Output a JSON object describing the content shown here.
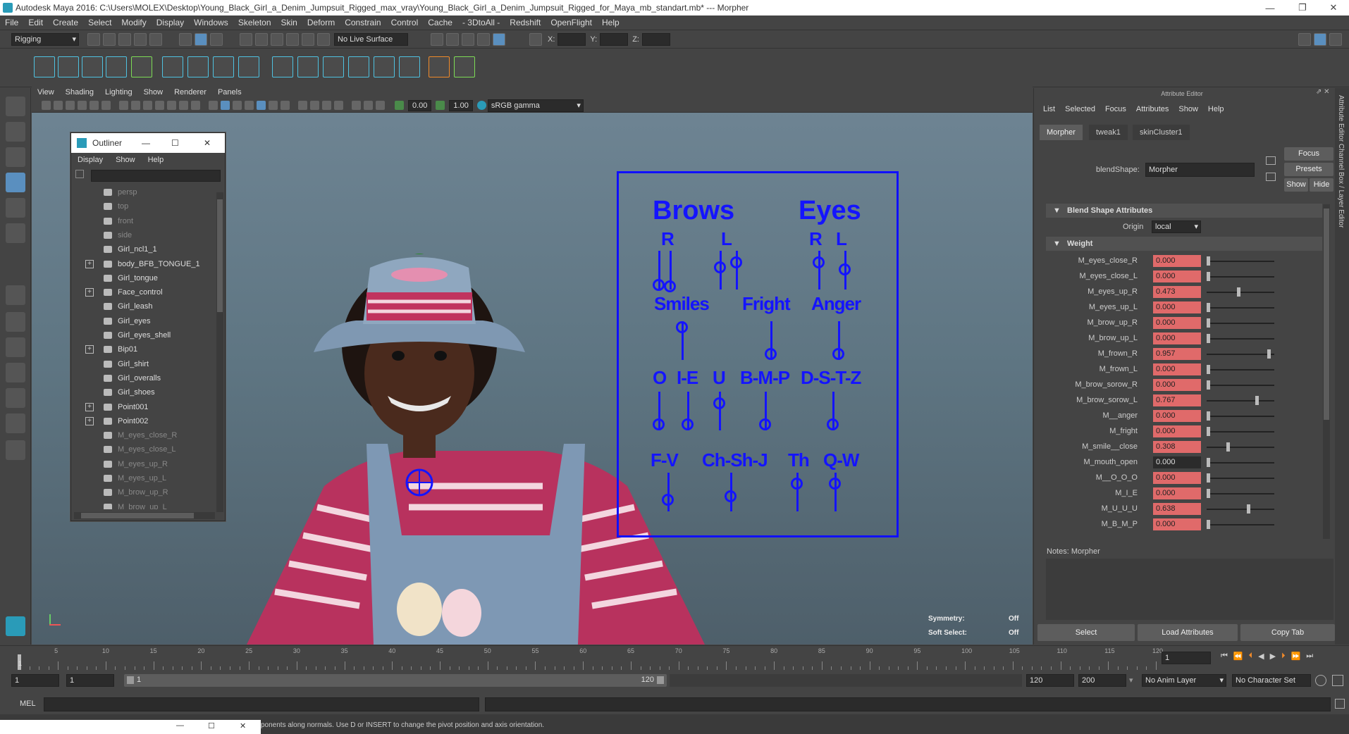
{
  "window": {
    "title": "Autodesk Maya 2016: C:\\Users\\MOLEX\\Desktop\\Young_Black_Girl_a_Denim_Jumpsuit_Rigged_max_vray\\Young_Black_Girl_a_Denim_Jumpsuit_Rigged_for_Maya_mb_standart.mb*  ---  Morpher"
  },
  "menu": [
    "File",
    "Edit",
    "Create",
    "Select",
    "Modify",
    "Display",
    "Windows",
    "Skeleton",
    "Skin",
    "Deform",
    "Constrain",
    "Control",
    "Cache",
    "- 3DtoAll -",
    "Redshift",
    "OpenFlight",
    "Help"
  ],
  "status": {
    "mode": "Rigging",
    "live_surface": "No Live Surface",
    "x": "X:",
    "y": "Y:",
    "z": "Z:"
  },
  "viewport": {
    "menu": [
      "View",
      "Shading",
      "Lighting",
      "Show",
      "Renderer",
      "Panels"
    ],
    "near": "0.00",
    "far": "1.00",
    "gamma": "sRGB gamma",
    "camera": "persp",
    "symmetry_label": "Symmetry:",
    "symmetry_value": "Off",
    "soft_label": "Soft Select:",
    "soft_value": "Off"
  },
  "face_panel": {
    "brows": "Brows",
    "eyes": "Eyes",
    "r1": "R",
    "l1": "L",
    "r2": "R",
    "l2": "L",
    "smiles": "Smiles",
    "fright": "Fright",
    "anger": "Anger",
    "o": "O",
    "ie": "I-E",
    "u": "U",
    "bmp": "B-M-P",
    "dstz": "D-S-T-Z",
    "fv": "F-V",
    "chshj": "Ch-Sh-J",
    "th": "Th",
    "qw": "Q-W"
  },
  "outliner": {
    "title": "Outliner",
    "menu": [
      "Display",
      "Show",
      "Help"
    ],
    "items": [
      {
        "label": "persp",
        "dim": true,
        "expand": false
      },
      {
        "label": "top",
        "dim": true,
        "expand": false
      },
      {
        "label": "front",
        "dim": true,
        "expand": false
      },
      {
        "label": "side",
        "dim": true,
        "expand": false
      },
      {
        "label": "Girl_ncl1_1",
        "dim": false,
        "expand": false
      },
      {
        "label": "body_BFB_TONGUE_1",
        "dim": false,
        "expand": true
      },
      {
        "label": "Girl_tongue",
        "dim": false,
        "expand": false
      },
      {
        "label": "Face_control",
        "dim": false,
        "expand": true
      },
      {
        "label": "Girl_leash",
        "dim": false,
        "expand": false
      },
      {
        "label": "Girl_eyes",
        "dim": false,
        "expand": false
      },
      {
        "label": "Girl_eyes_shell",
        "dim": false,
        "expand": false
      },
      {
        "label": "Bip01",
        "dim": false,
        "expand": true
      },
      {
        "label": "Girl_shirt",
        "dim": false,
        "expand": false
      },
      {
        "label": "Girl_overalls",
        "dim": false,
        "expand": false
      },
      {
        "label": "Girl_shoes",
        "dim": false,
        "expand": false
      },
      {
        "label": "Point001",
        "dim": false,
        "expand": true
      },
      {
        "label": "Point002",
        "dim": false,
        "expand": true
      },
      {
        "label": "M_eyes_close_R",
        "dim": true,
        "expand": false
      },
      {
        "label": "M_eyes_close_L",
        "dim": true,
        "expand": false
      },
      {
        "label": "M_eyes_up_R",
        "dim": true,
        "expand": false
      },
      {
        "label": "M_eyes_up_L",
        "dim": true,
        "expand": false
      },
      {
        "label": "M_brow_up_R",
        "dim": true,
        "expand": false
      },
      {
        "label": "M_brow_up_L",
        "dim": true,
        "expand": false
      }
    ]
  },
  "attr": {
    "title": "Attribute Editor",
    "menu": [
      "List",
      "Selected",
      "Focus",
      "Attributes",
      "Show",
      "Help"
    ],
    "tabs": [
      "Morpher",
      "tweak1",
      "skinCluster1"
    ],
    "blend_label": "blendShape:",
    "blend_value": "Morpher",
    "focus": "Focus",
    "presets": "Presets",
    "show": "Show",
    "hide": "Hide",
    "sec1": "Blend Shape Attributes",
    "origin_label": "Origin",
    "origin_value": "local",
    "sec2": "Weight",
    "weights": [
      {
        "name": "M_eyes_close_R",
        "value": "0.000",
        "keyed": true
      },
      {
        "name": "M_eyes_close_L",
        "value": "0.000",
        "keyed": true
      },
      {
        "name": "M_eyes_up_R",
        "value": "0.473",
        "keyed": true
      },
      {
        "name": "M_eyes_up_L",
        "value": "0.000",
        "keyed": true
      },
      {
        "name": "M_brow_up_R",
        "value": "0.000",
        "keyed": true
      },
      {
        "name": "M_brow_up_L",
        "value": "0.000",
        "keyed": true
      },
      {
        "name": "M_frown_R",
        "value": "0.957",
        "keyed": true
      },
      {
        "name": "M_frown_L",
        "value": "0.000",
        "keyed": true
      },
      {
        "name": "M_brow_sorow_R",
        "value": "0.000",
        "keyed": true
      },
      {
        "name": "M_brow_sorow_L",
        "value": "0.767",
        "keyed": true
      },
      {
        "name": "M__anger",
        "value": "0.000",
        "keyed": true
      },
      {
        "name": "M_fright",
        "value": "0.000",
        "keyed": true
      },
      {
        "name": "M_smile__close",
        "value": "0.308",
        "keyed": true
      },
      {
        "name": "M_mouth_open",
        "value": "0.000",
        "keyed": false
      },
      {
        "name": "M__O_O_O",
        "value": "0.000",
        "keyed": true
      },
      {
        "name": "M_I_E",
        "value": "0.000",
        "keyed": true
      },
      {
        "name": "M_U_U_U",
        "value": "0.638",
        "keyed": true
      },
      {
        "name": "M_B_M_P",
        "value": "0.000",
        "keyed": true
      }
    ],
    "notes": "Notes:  Morpher",
    "select": "Select",
    "load": "Load Attributes",
    "copy": "Copy Tab",
    "side_tabs": "Attribute Editor    Channel Box / Layer Editor"
  },
  "timeline": {
    "labels": [
      "5",
      "10",
      "15",
      "20",
      "25",
      "30",
      "35",
      "40",
      "45",
      "50",
      "55",
      "60",
      "65",
      "70",
      "75",
      "80",
      "85",
      "90",
      "95",
      "100",
      "105",
      "110",
      "115",
      "120"
    ],
    "current": "1",
    "first_tick": "1"
  },
  "range": {
    "start": "1",
    "start2": "1",
    "inner_start": "1",
    "inner_end": "120",
    "end": "120",
    "end2": "200",
    "anim_layer": "No Anim Layer",
    "char_set": "No Character Set"
  },
  "cmd": {
    "label": "MEL"
  },
  "help": {
    "text": "ponents along normals. Use D or INSERT to change the pivot position and axis orientation."
  }
}
